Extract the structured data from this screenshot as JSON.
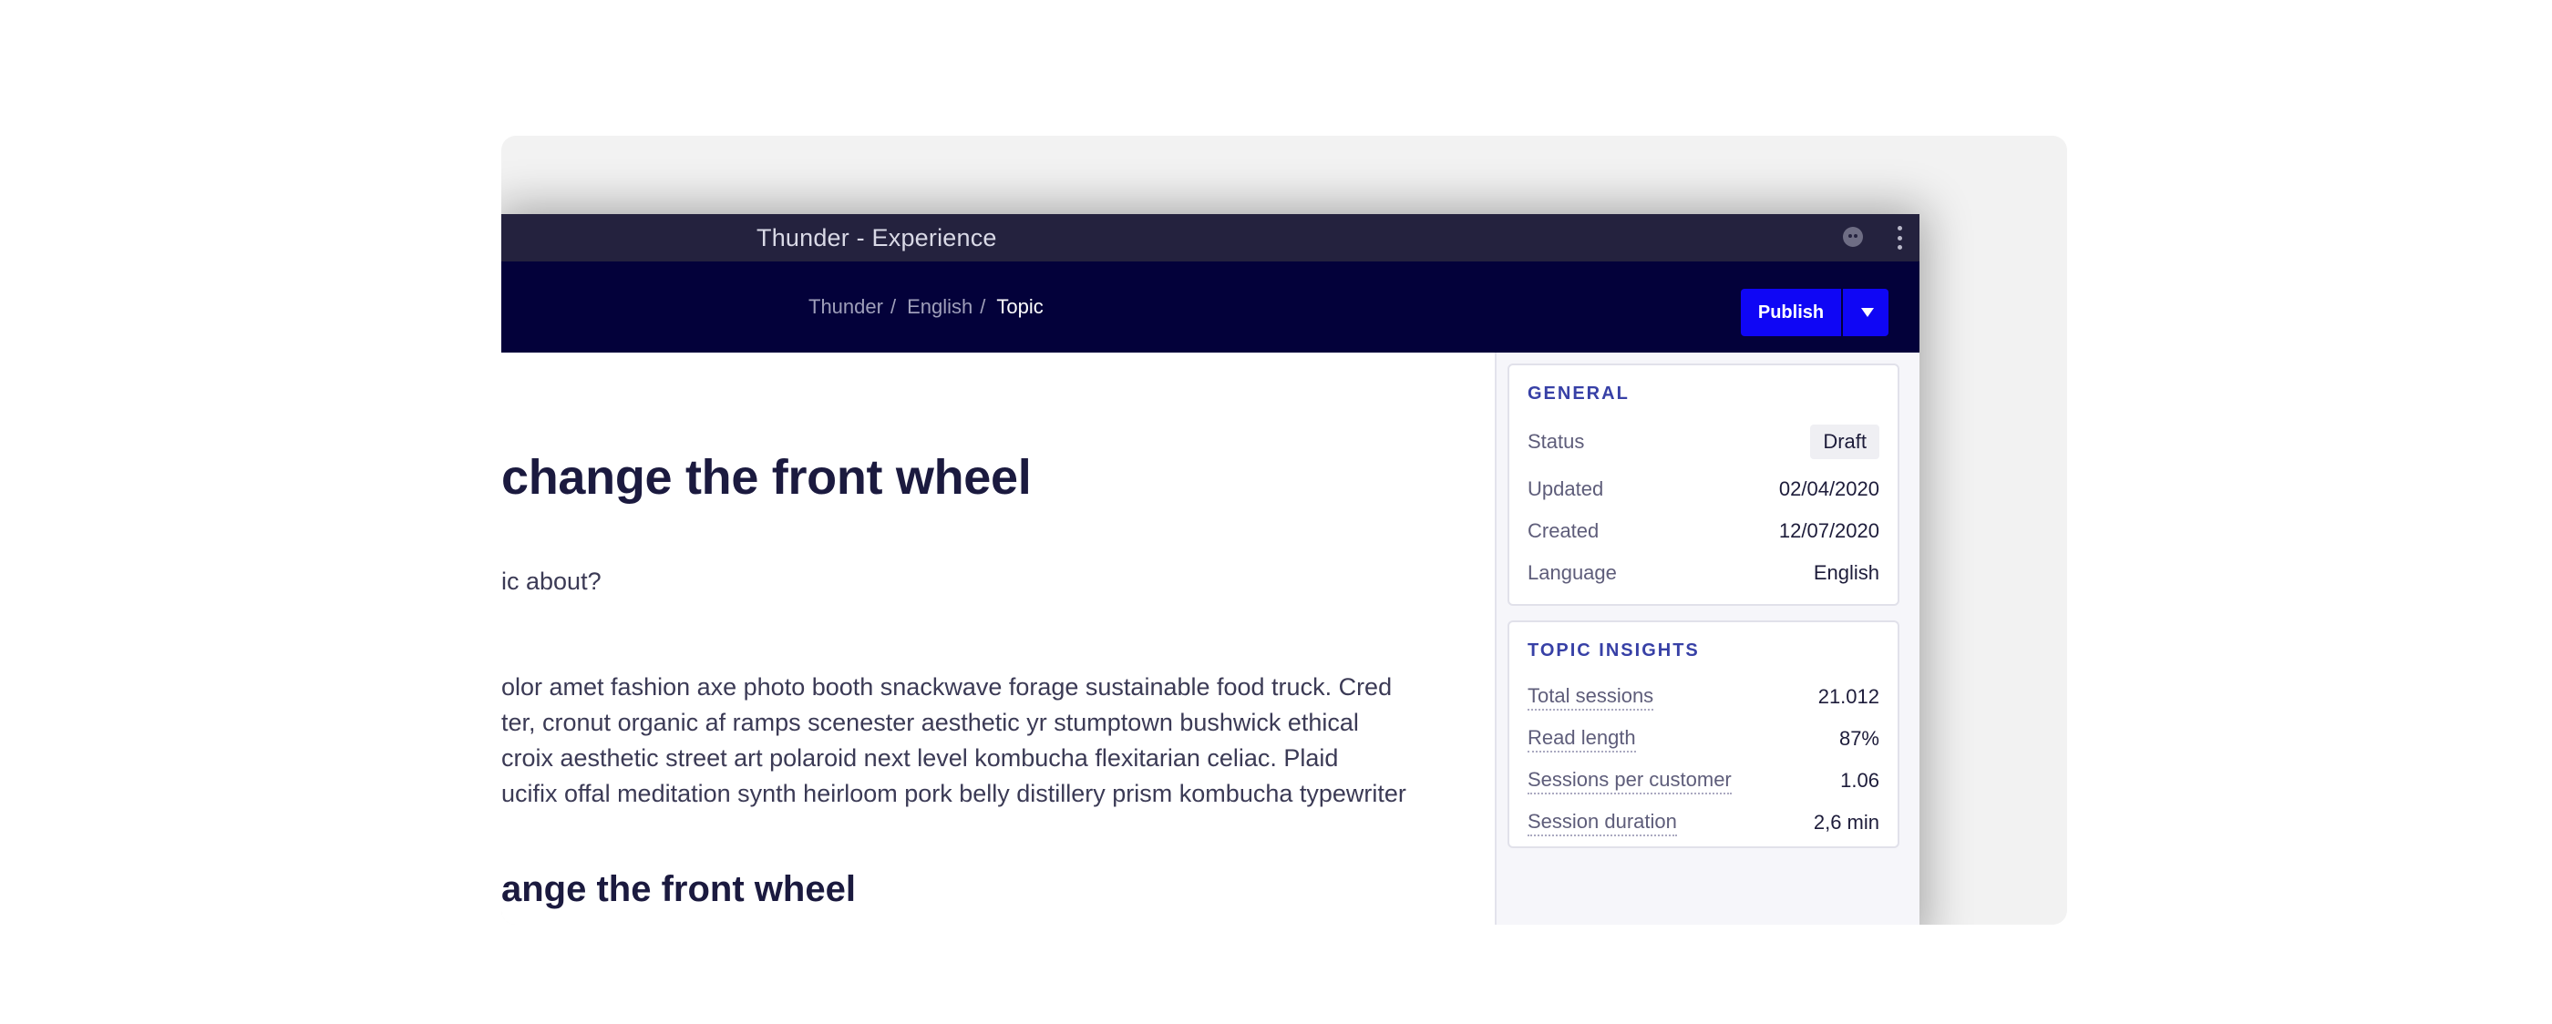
{
  "window": {
    "title": "Thunder - Experience"
  },
  "breadcrumb": [
    "Thunder",
    "English",
    "Topic"
  ],
  "toolbar": {
    "publish_label": "Publish"
  },
  "article": {
    "heading": "change the front wheel",
    "question": "ic about?",
    "paragraph_lines": [
      "olor amet fashion axe photo booth snackwave forage sustainable food truck. Cred",
      "ter, cronut organic af ramps scenester aesthetic yr stumptown bushwick ethical",
      "croix aesthetic street art polaroid next level kombucha flexitarian celiac. Plaid",
      "ucifix offal meditation synth heirloom pork belly distillery prism kombucha typewriter"
    ],
    "subheading": "ange the front wheel"
  },
  "general": {
    "title": "GENERAL",
    "status_label": "Status",
    "status_value": "Draft",
    "updated_label": "Updated",
    "updated_value": "02/04/2020",
    "created_label": "Created",
    "created_value": "12/07/2020",
    "language_label": "Language",
    "language_value": "English"
  },
  "insights": {
    "title": "TOPIC INSIGHTS",
    "total_sessions_label": "Total sessions",
    "total_sessions_value": "21.012",
    "read_length_label": "Read length",
    "read_length_value": "87%",
    "spc_label": "Sessions per customer",
    "spc_value": "1.06",
    "duration_label": "Session duration",
    "duration_value": "2,6 min"
  },
  "icons": [
    "emoji-icon",
    "more-vertical-icon",
    "chevron-down-icon"
  ],
  "colors": {
    "navbar": "#03013a",
    "titlebar": "#24223e",
    "accent": "#0f06f5",
    "section_title": "#3740a6"
  }
}
